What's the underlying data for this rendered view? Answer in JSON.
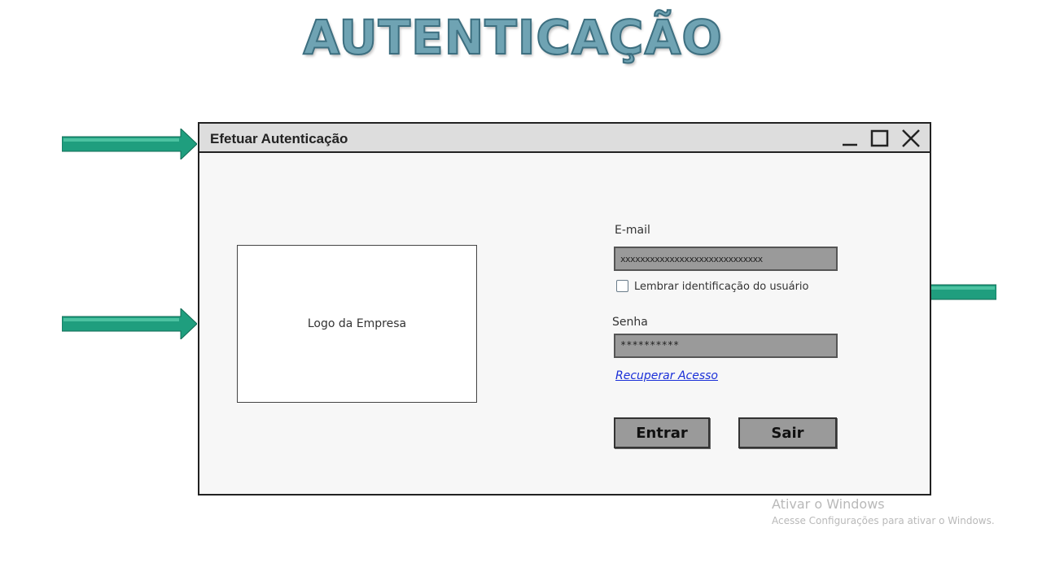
{
  "slide": {
    "title": "AUTENTICAÇÃO"
  },
  "window": {
    "title": "Efetuar Autenticação",
    "controls": {
      "minimize": "minimize-icon",
      "maximize": "maximize-icon",
      "close": "close-icon"
    }
  },
  "logo": {
    "placeholder": "Logo da Empresa"
  },
  "form": {
    "email_label": "E-mail",
    "email_value": "xxxxxxxxxxxxxxxxxxxxxxxxxxxxx",
    "remember_label": "Lembrar identificação do usuário",
    "remember_checked": false,
    "password_label": "Senha",
    "password_value": "**********",
    "recover_link": "Recuperar Acesso",
    "enter_button": "Entrar",
    "exit_button": "Sair"
  },
  "watermark": {
    "title": "Ativar o Windows",
    "subtitle": "Acesse Configurações para ativar o Windows."
  },
  "colors": {
    "arrow_fill": "#1f9e7e",
    "arrow_highlight": "#3fc49e",
    "field_bg": "#9a9a9a",
    "link": "#1a2fd8",
    "title_fill": "#6fa3b3"
  }
}
